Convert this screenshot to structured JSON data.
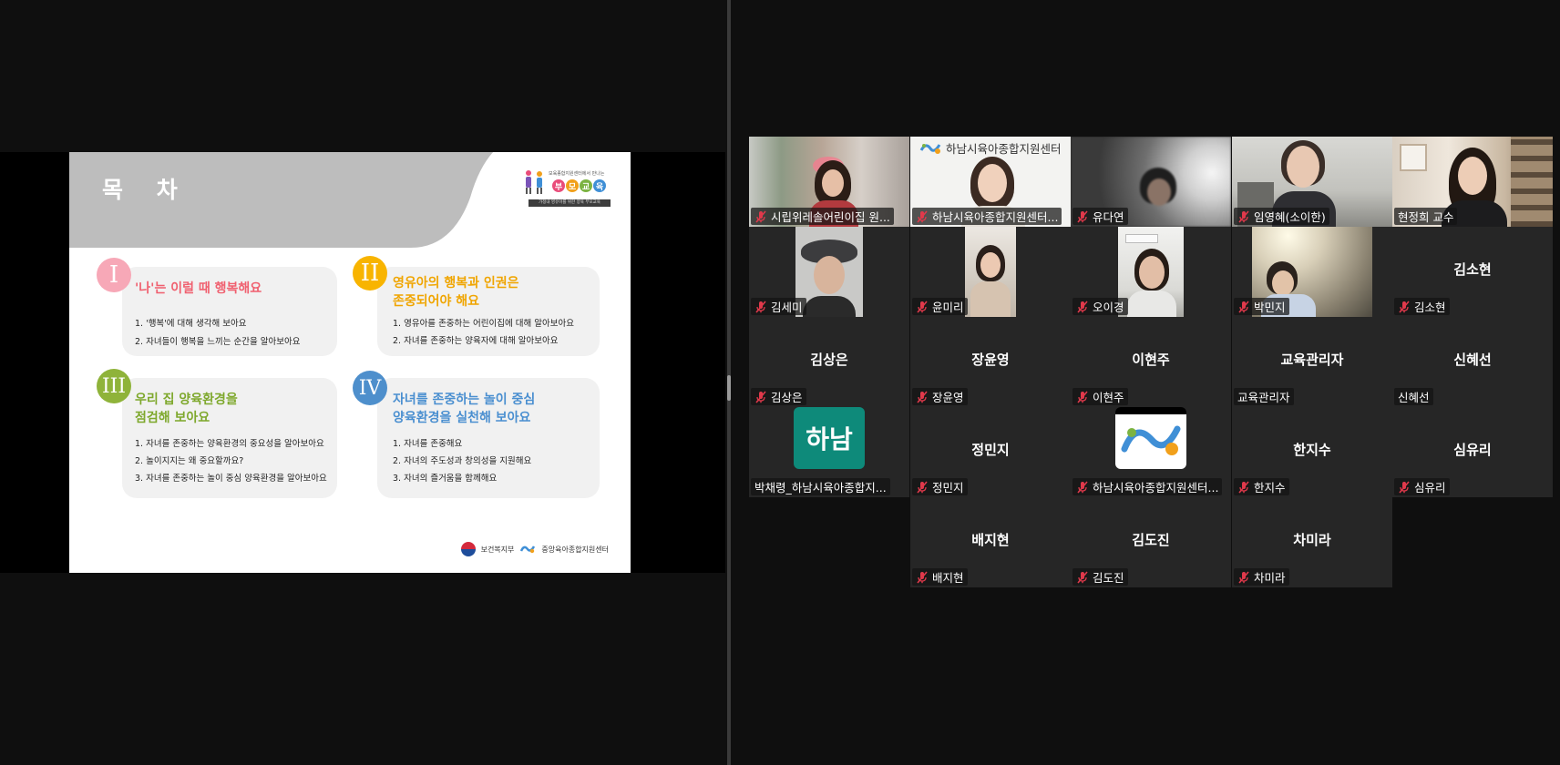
{
  "slide": {
    "title": "목 차",
    "brand": {
      "small_text": "보육종합지원센터에서 만나는",
      "word": [
        "부",
        "모",
        "교",
        "육"
      ],
      "word_colors": [
        "#e94c7a",
        "#f1a01b",
        "#7cb342",
        "#3f8fd6"
      ],
      "bar_text": "가정내 영유아를 위한 양육 부모교육"
    },
    "sections": [
      {
        "numeral": "I",
        "color": "#f7a8b7",
        "title_color": "#f0606f",
        "title": "'나'는 이럴 때 행복해요",
        "items": [
          "1. '행복'에 대해 생각해 보아요",
          "2. 자녀들이 행복을 느끼는 순간을 알아보아요"
        ]
      },
      {
        "numeral": "II",
        "color": "#f8b400",
        "title_color": "#f0a500",
        "title": "영유아의 행복과 인권은\n존중되어야 해요",
        "items": [
          "1. 영유아를 존중하는 어린이집에 대해 알아보아요",
          "2. 자녀를 존중하는 양육자에 대해 알아보아요"
        ]
      },
      {
        "numeral": "III",
        "color": "#8fb33a",
        "title_color": "#7ea82c",
        "title": "우리 집 양육환경을\n점검해 보아요",
        "items": [
          "1. 자녀를 존중하는 양육환경의 중요성을 알아보아요",
          "2. 놀이지지는 왜 중요할까요?",
          "3. 자녀를 존중하는 놀이 중심 양육환경을 알아보아요"
        ]
      },
      {
        "numeral": "IV",
        "color": "#4e8fcc",
        "title_color": "#4a8fd0",
        "title": "자녀를 존중하는 놀이 중심\n양육환경을 실천해 보아요",
        "items": [
          "1. 자녀를 존중해요",
          "2. 자녀의 주도성과 창의성을 지원해요",
          "3. 자녀의 즐거움을 함께해요"
        ]
      }
    ],
    "footer": {
      "ministry": "보건복지부",
      "center": "중앙육아종합지원센터"
    }
  },
  "gallery": {
    "accent": "#23d96a",
    "participants": [
      {
        "name": "시립위레솔어린이집 원...",
        "muted": true,
        "video": "photo-classroom"
      },
      {
        "name": "하남시육아종합지원센터...",
        "muted": true,
        "video": "photo-center",
        "overlay": "하남시육아종합지원센터"
      },
      {
        "name": "유다연",
        "muted": true,
        "video": "photo-blur"
      },
      {
        "name": "임영혜(소이한)",
        "muted": true,
        "video": "photo-office"
      },
      {
        "name": "현정희 교수",
        "muted": false,
        "video": "photo-library",
        "active": true
      },
      {
        "name": "김세미",
        "muted": true,
        "video": "photo-hat"
      },
      {
        "name": "윤미리",
        "muted": true,
        "video": "photo-phone"
      },
      {
        "name": "오이경",
        "muted": true,
        "video": "photo-room"
      },
      {
        "name": "박민지",
        "muted": true,
        "video": "photo-light"
      },
      {
        "name": "김소현",
        "muted": true,
        "video": "none",
        "big": "김소현"
      },
      {
        "name": "김상은",
        "muted": true,
        "video": "none",
        "big": "김상은"
      },
      {
        "name": "장윤영",
        "muted": true,
        "video": "none",
        "big": "장윤영"
      },
      {
        "name": "이현주",
        "muted": true,
        "video": "none",
        "big": "이현주"
      },
      {
        "name": "교육관리자",
        "muted": false,
        "video": "none",
        "big": "교육관리자"
      },
      {
        "name": "신혜선",
        "muted": false,
        "video": "none",
        "big": "신혜선"
      },
      {
        "name": "박채령_하남시육아종합지...",
        "muted": false,
        "video": "logo-hanam",
        "logo_text": "하남"
      },
      {
        "name": "정민지",
        "muted": true,
        "video": "none",
        "big": "정민지"
      },
      {
        "name": "하남시육아종합지원센터...",
        "muted": true,
        "video": "logo-swirl"
      },
      {
        "name": "한지수",
        "muted": true,
        "video": "none",
        "big": "한지수"
      },
      {
        "name": "심유리",
        "muted": true,
        "video": "none",
        "big": "심유리"
      },
      {
        "name": "배지현",
        "muted": true,
        "video": "none",
        "big": "배지현"
      },
      {
        "name": "김도진",
        "muted": true,
        "video": "none",
        "big": "김도진"
      },
      {
        "name": "차미라",
        "muted": true,
        "video": "none",
        "big": "차미라"
      }
    ]
  }
}
